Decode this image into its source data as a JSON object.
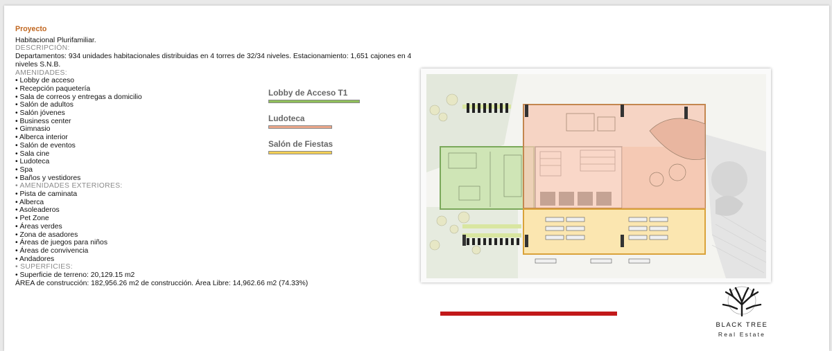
{
  "project": {
    "heading": "Proyecto",
    "type": "Habitacional Plurifamiliar.",
    "descripcion_label": "DESCRIPCIÓN:",
    "descripcion": "Departamentos: 934 unidades habitacionales distribuidas en 4 torres de 32/34 niveles. Estacionamiento: 1,651 cajones en 4 niveles S.N.B.",
    "amenidades_label": "AMENIDADES:",
    "amenidades": [
      "• Lobby de acceso",
      "• Recepción paquetería",
      "• Sala de correos y entregas a domicilio",
      "• Salón de adultos",
      "• Salón jóvenes",
      "• Business center",
      "• Gimnasio",
      "• Alberca interior",
      "• Salón de eventos",
      "• Sala cine",
      "• Ludoteca",
      "• Spa",
      "• Baños y vestidores"
    ],
    "exteriores_label": "• AMENIDADES EXTERIORES:",
    "exteriores": [
      "• Pista de caminata",
      "• Alberca",
      "• Asoleaderos",
      "• Pet Zone",
      "• Áreas verdes",
      "• Zona de asadores",
      "• Áreas de juegos para niños",
      "• Áreas de convivencia",
      "• Andadores"
    ],
    "superficies_label": "• SUPERFICIES:",
    "superficie_terreno": "• Superficie de terreno: 20,129.15 m2",
    "area_construccion": "ÁREA de construcción: 182,956.26 m2 de construcción. Área Libre: 14,962.66 m2 (74.33%)"
  },
  "legend": [
    {
      "label": "Lobby de Acceso T1",
      "color": "#8fbf5a"
    },
    {
      "label": "Ludoteca",
      "color": "#eba78a"
    },
    {
      "label": "Salón de Fiestas",
      "color": "#f3cf55"
    }
  ],
  "plan": {
    "zone_lobby_color": "#cfe5b6",
    "zone_ludoteca_color": "#f7c9b5",
    "zone_fiestas_color": "#fbe6b0"
  },
  "accent": {
    "red_bar": "#c2191a"
  },
  "logo": {
    "name": "BLACK TREE",
    "sub": "Real Estate"
  }
}
